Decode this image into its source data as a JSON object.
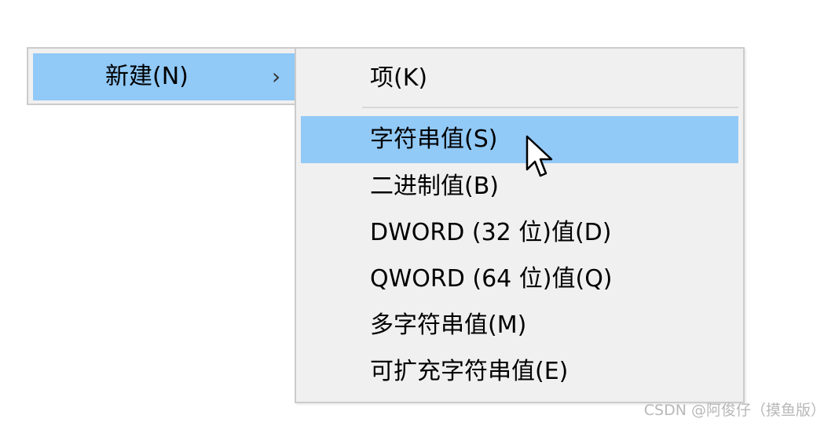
{
  "parent_menu": {
    "item": {
      "label": "新建(N)",
      "arrow": "›",
      "arrow_icon": "chevron-right-icon"
    }
  },
  "submenu": {
    "items": [
      {
        "label": "项(K)"
      },
      {
        "label": "字符串值(S)"
      },
      {
        "label": "二进制值(B)"
      },
      {
        "label": "DWORD (32 位)值(D)"
      },
      {
        "label": "QWORD (64 位)值(Q)"
      },
      {
        "label": "多字符串值(M)"
      },
      {
        "label": "可扩充字符串值(E)"
      }
    ],
    "highlighted_index": 1
  },
  "cursor": {
    "icon": "mouse-pointer-icon"
  },
  "colors": {
    "menu_background": "#f0f0f0",
    "highlight": "#91c9f7",
    "border": "#cccccc",
    "separator": "#d7d7d7"
  },
  "watermark": {
    "text": "CSDN @阿俊仔（摸鱼版）"
  }
}
